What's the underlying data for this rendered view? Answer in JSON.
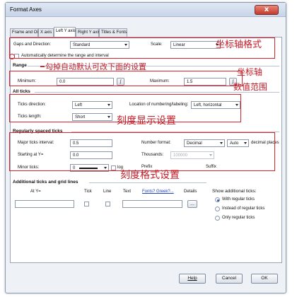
{
  "window": {
    "title": "Format Axes",
    "close_glyph": "x"
  },
  "tabs": [
    {
      "label": "Frame and Origin",
      "active": false
    },
    {
      "label": "X axis",
      "active": false
    },
    {
      "label": "Left Y axis",
      "active": true
    },
    {
      "label": "Right Y axis",
      "active": false
    },
    {
      "label": "Titles & Fonts",
      "active": false
    }
  ],
  "gaps": {
    "label": "Gaps and Direction:",
    "value": "Standard"
  },
  "scale": {
    "label": "Scale:",
    "value": "Linear"
  },
  "auto_range": {
    "label": "Automatically determine the range and interval",
    "checked": false
  },
  "range": {
    "heading": "Range",
    "minimum_label": "Minimum:",
    "minimum_value": "0.0",
    "maximum_label": "Maximum:",
    "maximum_value": "1.5",
    "calc_glyph": "∫"
  },
  "all_ticks": {
    "heading": "All ticks",
    "direction_label": "Ticks direction:",
    "direction_value": "Left",
    "location_label": "Location of numbering/labeling:",
    "location_value": "Left, horizontal",
    "length_label": "Ticks length:",
    "length_value": "Short"
  },
  "regular_ticks": {
    "heading": "Regularly spaced ticks",
    "major_label": "Major ticks interval:",
    "major_value": "0.5",
    "start_label": "Starting at Y=",
    "start_value": "0.0",
    "minor_label": "Minor ticks:",
    "minor_value": "0",
    "log_label": "log",
    "number_format_label": "Number format:",
    "number_format_value": "Decimal",
    "auto_value": "Auto",
    "decimal_places_label": "decimal places",
    "thousands_label": "Thousands:",
    "thousands_value": "100000",
    "prefix_label": "Prefix",
    "suffix_label": "Suffix"
  },
  "additional": {
    "heading": "Additional ticks and grid lines",
    "col_at": "At Y=",
    "col_tick": "Tick",
    "col_line": "Line",
    "col_text": "Text",
    "col_fonts": "Fonts? Greek?...",
    "col_details": "Details",
    "details_btn": "...",
    "show_heading": "Show additional ticks:",
    "options": [
      {
        "label": "With regular ticks",
        "selected": true
      },
      {
        "label": "Instead of regular ticks",
        "selected": false
      },
      {
        "label": "Only regular ticks",
        "selected": false
      }
    ]
  },
  "buttons": {
    "help": "Help",
    "cancel": "Cancel",
    "ok": "OK"
  },
  "annotations": {
    "axis_format": "坐标轴格式",
    "uncheck_hint": "勾掉自动默认可改下面的设置",
    "range_line1": "坐标轴",
    "range_line2": "数值范围",
    "tick_display": "刻度显示设置",
    "tick_format": "刻度格式设置"
  },
  "colors": {
    "annotation_red": "#d9232e",
    "link_blue": "#1d3fc0",
    "title_bar": "#c8d5e8"
  }
}
